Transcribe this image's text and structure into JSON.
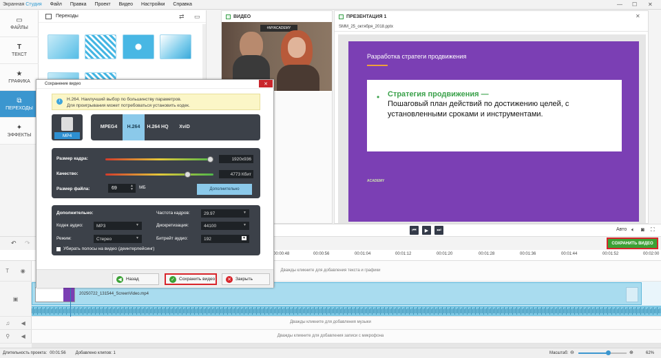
{
  "app": {
    "name_part1": "Экранная",
    "name_part2": "Студия",
    "menu": [
      "Файл",
      "Правка",
      "Проект",
      "Видео",
      "Настройки",
      "Справка"
    ]
  },
  "left_tabs": [
    {
      "label": "ФАЙЛЫ",
      "icon": "image-icon"
    },
    {
      "label": "ТЕКСТ",
      "icon": "text-icon"
    },
    {
      "label": "ГРАФИКА",
      "icon": "star-icon"
    },
    {
      "label": "ПЕРЕХОДЫ",
      "icon": "transitions-icon",
      "active": true
    },
    {
      "label": "ЭФФЕКТЫ",
      "icon": "effects-icon"
    }
  ],
  "transitions": {
    "title": "Переходы"
  },
  "video_panel": {
    "title": "ВИДЕО",
    "banner": "#MYACADEMY"
  },
  "presentation": {
    "title": "ПРЕЗЕНТАЦИЯ 1",
    "file": "SMM_25_октября_2018.pptx",
    "slide_title": "Разработка стратеги продвижения",
    "bullet_heading": "Стратегия продвижения —",
    "bullet_text": "Пошаговый план действий по достижению целей, с установленными сроками и инструментами.",
    "logo": "ACADEMY"
  },
  "player": {
    "auto_label": "Авто"
  },
  "save_video_label": "СОХРАНИТЬ ВИДЕО",
  "ruler_ticks": [
    "00:00:48",
    "00:00:56",
    "00:01:04",
    "00:01:12",
    "00:01:20",
    "00:01:28",
    "00:01:36",
    "00:01:44",
    "00:01:52",
    "00:02:00"
  ],
  "tracks": {
    "text_hint": "Дважды кликните для добавления текста и графики",
    "music_hint": "Дважды кликните для добавления музыки",
    "mic_hint": "Дважды кликните для добавления записи с микрофона",
    "clip_name": "20250722_131544_ScreenVideo.mp4"
  },
  "status": {
    "duration_label": "Длительность проекта:",
    "duration": "00:01:56",
    "clips_label": "Добавлено клипов: 1",
    "zoom_label": "Масштаб:",
    "zoom": "62%",
    "zoom_fraction": 0.62
  },
  "dialog": {
    "title": "Сохранение видео",
    "info_line1": "H.264. Наилучший выбор по большинству параметров.",
    "info_line2": "Для проигрывания может потребоваться установить кодек.",
    "format": "MP4",
    "codecs": [
      "MPEG4",
      "H.264",
      "H.264 HQ",
      "XviD"
    ],
    "selected_codec": "H.264",
    "frame_size_label": "Размер кадра:",
    "frame_size": "1920x936",
    "frame_size_level": 0.97,
    "quality_label": "Качество:",
    "quality": "4773 Кбит",
    "quality_level": 0.76,
    "file_size_label": "Размер файла:",
    "file_size": "69",
    "file_size_unit": "МБ",
    "advanced_button": "Дополнительно",
    "extra_heading": "Дополнительно:",
    "audio_codec_label": "Кодек аудио:",
    "audio_codec": "MP3",
    "mode_label": "Режим:",
    "mode": "Стерео",
    "fps_label": "Частота кадров:",
    "fps": "29.97",
    "sampling_label": "Дискретизация:",
    "sampling": "44100",
    "bitrate_label": "Битрейт аудио:",
    "bitrate": "192",
    "deinterlace_label": "Убирать полосы на видео (деинтерлейсинг)",
    "back_button": "Назад",
    "save_button": "Сохранить видео",
    "close_button": "Закрыть"
  }
}
